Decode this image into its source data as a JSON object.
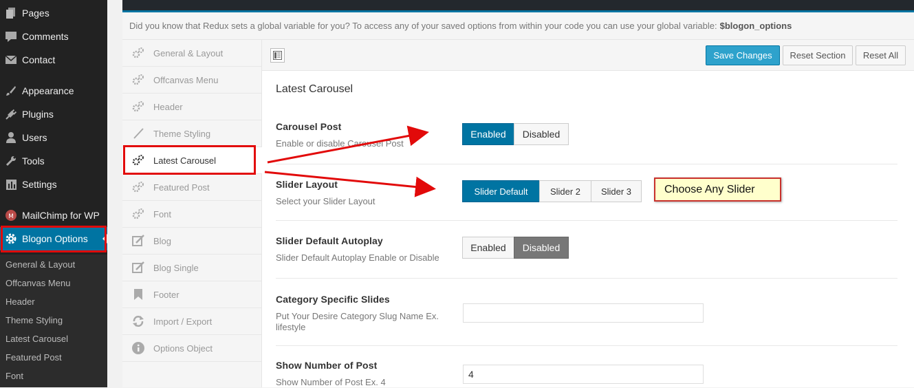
{
  "sidebar": {
    "items": [
      {
        "label": "Pages",
        "icon": "pages-icon"
      },
      {
        "label": "Comments",
        "icon": "comments-icon"
      },
      {
        "label": "Contact",
        "icon": "mail-icon"
      },
      {
        "label": "Appearance",
        "icon": "brush-icon"
      },
      {
        "label": "Plugins",
        "icon": "plug-icon"
      },
      {
        "label": "Users",
        "icon": "user-icon"
      },
      {
        "label": "Tools",
        "icon": "wrench-icon"
      },
      {
        "label": "Settings",
        "icon": "settings-icon"
      },
      {
        "label": "MailChimp for WP",
        "icon": "mailchimp-icon"
      },
      {
        "label": "Blogon Options",
        "icon": "gear-icon"
      }
    ],
    "submenu": [
      "General & Layout",
      "Offcanvas Menu",
      "Header",
      "Theme Styling",
      "Latest Carousel",
      "Featured Post",
      "Font"
    ]
  },
  "notice": {
    "text": "Did you know that Redux sets a global variable for you? To access any of your saved options from within your code you can use your global variable:",
    "variable": "$blogon_options"
  },
  "menu": [
    {
      "label": "General & Layout",
      "icon": "gears-icon"
    },
    {
      "label": "Offcanvas Menu",
      "icon": "gears-icon"
    },
    {
      "label": "Header",
      "icon": "gears-icon"
    },
    {
      "label": "Theme Styling",
      "icon": "brush-icon"
    },
    {
      "label": "Latest Carousel",
      "icon": "gears-icon"
    },
    {
      "label": "Featured Post",
      "icon": "gears-icon"
    },
    {
      "label": "Font",
      "icon": "gears-icon"
    },
    {
      "label": "Blog",
      "icon": "edit-icon"
    },
    {
      "label": "Blog Single",
      "icon": "edit-icon"
    },
    {
      "label": "Footer",
      "icon": "bookmark-icon"
    },
    {
      "label": "Import / Export",
      "icon": "refresh-icon"
    },
    {
      "label": "Options Object",
      "icon": "info-icon"
    }
  ],
  "toolbar": {
    "save": "Save Changes",
    "reset_section": "Reset Section",
    "reset_all": "Reset All"
  },
  "section": {
    "title": "Latest Carousel",
    "carousel_post": {
      "title": "Carousel Post",
      "desc": "Enable or disable Carousel Post",
      "options": [
        "Enabled",
        "Disabled"
      ],
      "selected": "Enabled"
    },
    "slider_layout": {
      "title": "Slider Layout",
      "desc": "Select your Slider Layout",
      "options": [
        "Slider Default",
        "Slider 2",
        "Slider 3"
      ],
      "selected": "Slider Default"
    },
    "autoplay": {
      "title": "Slider Default Autoplay",
      "desc": "Slider Default Autoplay Enable or Disable",
      "options": [
        "Enabled",
        "Disabled"
      ],
      "selected": "Disabled"
    },
    "category": {
      "title": "Category Specific Slides",
      "desc": "Put Your Desire Category Slug Name Ex. lifestyle",
      "value": ""
    },
    "num_post": {
      "title": "Show Number of Post",
      "desc": "Show Number of Post Ex. 4",
      "value": "4"
    }
  },
  "callout": "Choose Any Slider",
  "colors": {
    "accent": "#0074a2",
    "annotation": "#e20a0a"
  }
}
